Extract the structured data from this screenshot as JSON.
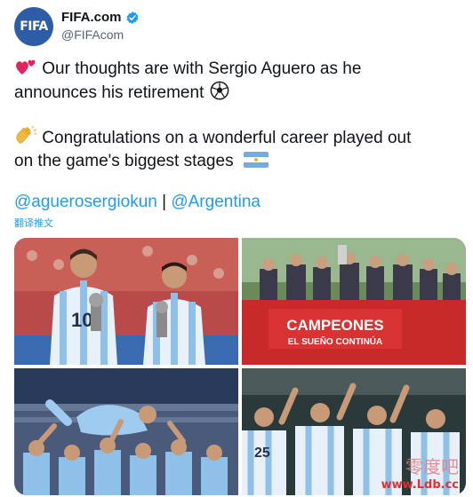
{
  "account": {
    "avatar_text": "FIFA",
    "display_name": "FIFA.com",
    "handle": "@FIFAcom",
    "verified": true
  },
  "tweet": {
    "line1": "Our thoughts are with Sergio Aguero as he",
    "line2": "announces his retirement",
    "line3": "Congratulations on a wonderful career played out",
    "line4": "on the game's biggest stages",
    "mention1": "@aguerosergiokun",
    "separator": " | ",
    "mention2": "@Argentina",
    "translate_label": "翻译推文"
  },
  "icons": {
    "hearts": "two-hearts-icon",
    "clap": "clapping-hands-icon",
    "ball": "soccer-ball-icon",
    "flag": "argentina-flag-icon",
    "verified": "verified-badge-icon"
  },
  "photos": {
    "photo3_banner_line1": "CAMPEONES",
    "photo3_banner_line2": "EL SUEÑO CONTINÚA",
    "jersey_numbers": [
      "10",
      "25"
    ]
  },
  "watermark": {
    "chinese": "零度吧",
    "url": "www.Ldb.cc"
  },
  "colors": {
    "link": "#1d9bf0",
    "secondary_text": "#536471",
    "avatar_bg": "#2d5da6"
  }
}
